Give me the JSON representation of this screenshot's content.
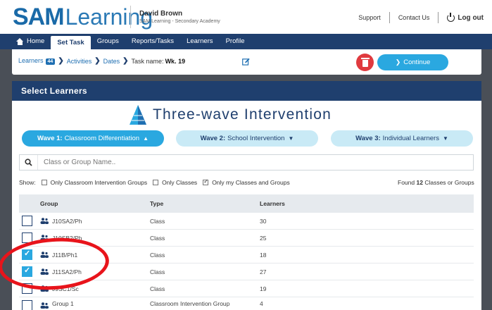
{
  "header": {
    "logo_sam": "SAM",
    "logo_learning": "Learning",
    "user_name": "David Brown",
    "user_school": "SAM Learning - Secondary Academy",
    "links": [
      "Support",
      "Contact Us"
    ],
    "logout": "Log out"
  },
  "nav": {
    "items": [
      {
        "label": "Home"
      },
      {
        "label": "Set Task"
      },
      {
        "label": "Groups"
      },
      {
        "label": "Reports/Tasks"
      },
      {
        "label": "Learners"
      },
      {
        "label": "Profile"
      }
    ],
    "active": "Set Task"
  },
  "taskbar": {
    "crumbs": {
      "learners": "Learners",
      "learners_count": "44",
      "activities": "Activities",
      "dates": "Dates",
      "task_label": "Task name:",
      "task_name": "Wk. 19"
    },
    "continue_label": "Continue"
  },
  "panel": {
    "title": "Select Learners",
    "intervention_title": "Three-wave Intervention",
    "waves": [
      {
        "prefix": "Wave 1:",
        "label": "Classroom Differentiation",
        "active": true
      },
      {
        "prefix": "Wave 2:",
        "label": "School Intervention",
        "active": false
      },
      {
        "prefix": "Wave 3:",
        "label": "Individual Learners",
        "active": false
      }
    ],
    "search_placeholder": "Class or Group Name..",
    "filters": {
      "show_label": "Show:",
      "items": [
        {
          "label": "Only Classroom Intervention Groups",
          "checked": false
        },
        {
          "label": "Only Classes",
          "checked": false
        },
        {
          "label": "Only my Classes and Groups",
          "checked": true
        }
      ]
    },
    "found": {
      "prefix": "Found",
      "count": "12",
      "suffix": "Classes or Groups"
    },
    "table": {
      "headers": [
        "Group",
        "Type",
        "Learners"
      ],
      "rows": [
        {
          "group": "J10SA2/Ph",
          "type": "Class",
          "learners": "30",
          "checked": false
        },
        {
          "group": "J10SB2/Ph",
          "type": "Class",
          "learners": "25",
          "checked": false
        },
        {
          "group": "J11B/Ph1",
          "type": "Class",
          "learners": "18",
          "checked": true
        },
        {
          "group": "J11SA2/Ph",
          "type": "Class",
          "learners": "27",
          "checked": true
        },
        {
          "group": "J9SC1/Sc",
          "type": "Class",
          "learners": "19",
          "checked": false
        },
        {
          "group": "Group 1",
          "type": "Classroom Intervention Group",
          "learners": "4",
          "checked": false
        }
      ]
    }
  },
  "colors": {
    "navy": "#1f3f6e",
    "accent_blue": "#2aa8e0",
    "light_blue": "#c9eaf6",
    "delete_red": "#e03a3f",
    "annotation_red": "#e8141b"
  }
}
